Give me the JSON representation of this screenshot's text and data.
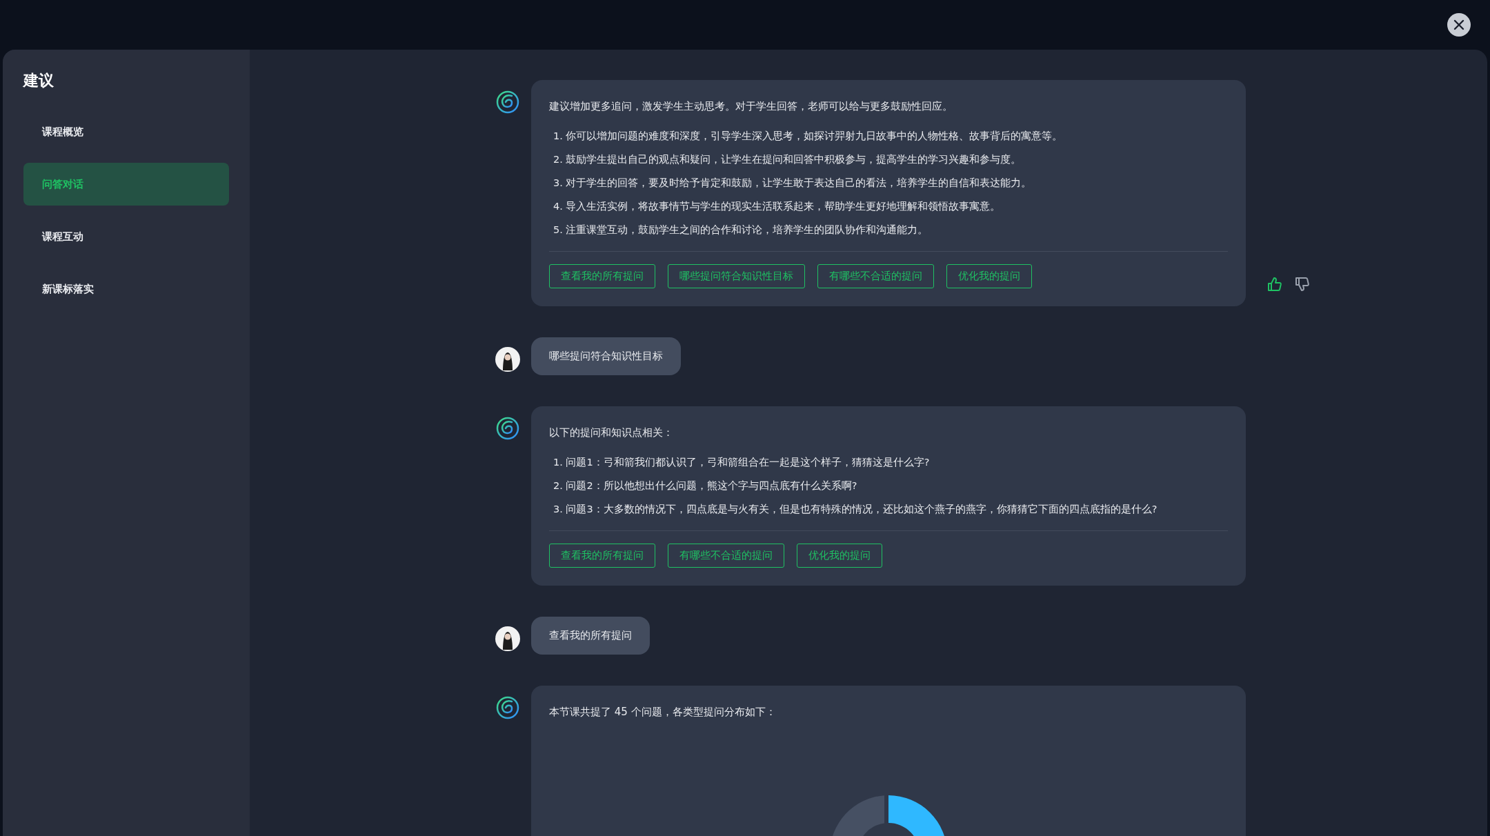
{
  "sidebar": {
    "title": "建议",
    "items": [
      {
        "label": "课程概览",
        "selected": false
      },
      {
        "label": "问答对话",
        "selected": true
      },
      {
        "label": "课程互动",
        "selected": false
      },
      {
        "label": "新课标落实",
        "selected": false
      }
    ]
  },
  "messages": [
    {
      "kind": "bot",
      "intro": "建议增加更多追问，激发学生主动思考。对于学生回答，老师可以给与更多鼓励性回应。",
      "list": [
        "1. 你可以增加问题的难度和深度，引导学生深入思考，如探讨羿射九日故事中的人物性格、故事背后的寓意等。",
        "2. 鼓励学生提出自己的观点和疑问，让学生在提问和回答中积极参与，提高学生的学习兴趣和参与度。",
        "3. 对于学生的回答，要及时给予肯定和鼓励，让学生敢于表达自己的看法，培养学生的自信和表达能力。",
        "4. 导入生活实例，将故事情节与学生的现实生活联系起来，帮助学生更好地理解和领悟故事寓意。",
        "5. 注重课堂互动，鼓励学生之间的合作和讨论，培养学生的团队协作和沟通能力。"
      ],
      "suggestions": [
        "查看我的所有提问",
        "哪些提问符合知识性目标",
        "有哪些不合适的提问",
        "优化我的提问"
      ],
      "liked": true,
      "disliked": false
    },
    {
      "kind": "user",
      "text": "哪些提问符合知识性目标"
    },
    {
      "kind": "bot",
      "intro": "以下的提问和知识点相关：",
      "list": [
        "1. 问题1：弓和箭我们都认识了，弓和箭组合在一起是这个样子，猜猜这是什么字?",
        "2. 问题2：所以他想出什么问题，熊这个字与四点底有什么关系啊?",
        "3. 问题3：大多数的情况下，四点底是与火有关，但是也有特殊的情况，还比如这个燕子的燕字，你猜猜它下面的四点底指的是什么?"
      ],
      "suggestions": [
        "查看我的所有提问",
        "有哪些不合适的提问",
        "优化我的提问"
      ]
    },
    {
      "kind": "user",
      "text": "查看我的所有提问"
    },
    {
      "kind": "chart",
      "intro": "本节课共提了 45 个问题，各类型提问分布如下："
    }
  ]
}
